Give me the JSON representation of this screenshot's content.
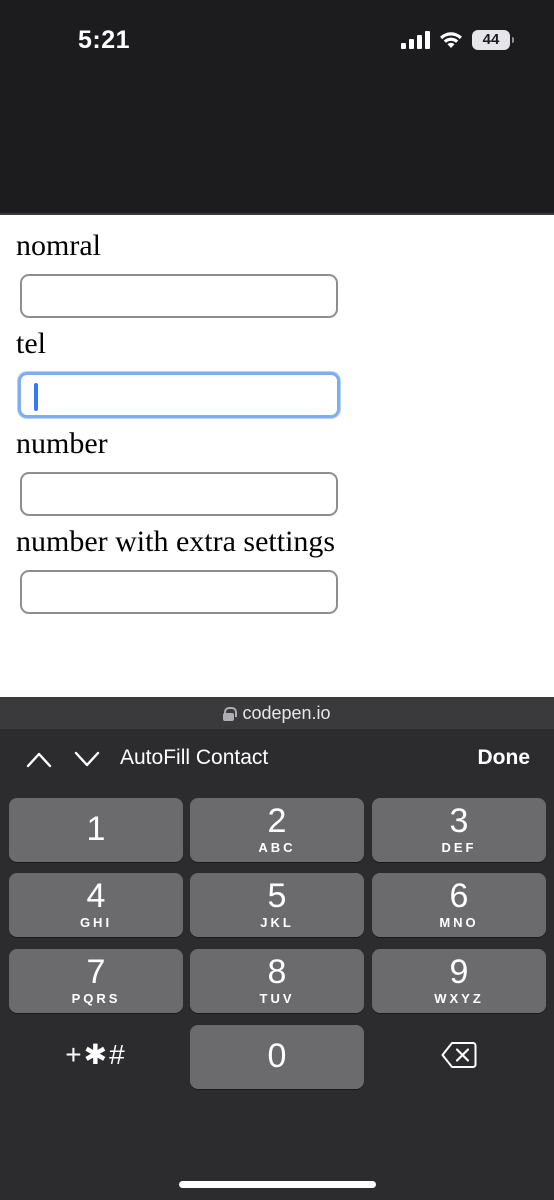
{
  "status_bar": {
    "time": "5:21",
    "battery": "44"
  },
  "form": {
    "fields": [
      {
        "label": "nomral",
        "value": ""
      },
      {
        "label": "tel",
        "value": ""
      },
      {
        "label": "number",
        "value": ""
      },
      {
        "label": "number with extra settings",
        "value": ""
      }
    ]
  },
  "browser": {
    "url": "codepen.io"
  },
  "accessory_bar": {
    "autofill_label": "AutoFill Contact",
    "done_label": "Done"
  },
  "keypad": {
    "keys": [
      {
        "num": "1",
        "letters": ""
      },
      {
        "num": "2",
        "letters": "ABC"
      },
      {
        "num": "3",
        "letters": "DEF"
      },
      {
        "num": "4",
        "letters": "GHI"
      },
      {
        "num": "5",
        "letters": "JKL"
      },
      {
        "num": "6",
        "letters": "MNO"
      },
      {
        "num": "7",
        "letters": "PQRS"
      },
      {
        "num": "8",
        "letters": "TUV"
      },
      {
        "num": "9",
        "letters": "WXYZ"
      },
      {
        "num": "+✱#",
        "letters": ""
      },
      {
        "num": "0",
        "letters": ""
      }
    ],
    "delete_icon": "backspace-icon"
  },
  "colors": {
    "focus_ring": "#7eaef0",
    "keyboard_bg": "#2c2c2e",
    "key_bg": "#6b6b6e"
  }
}
